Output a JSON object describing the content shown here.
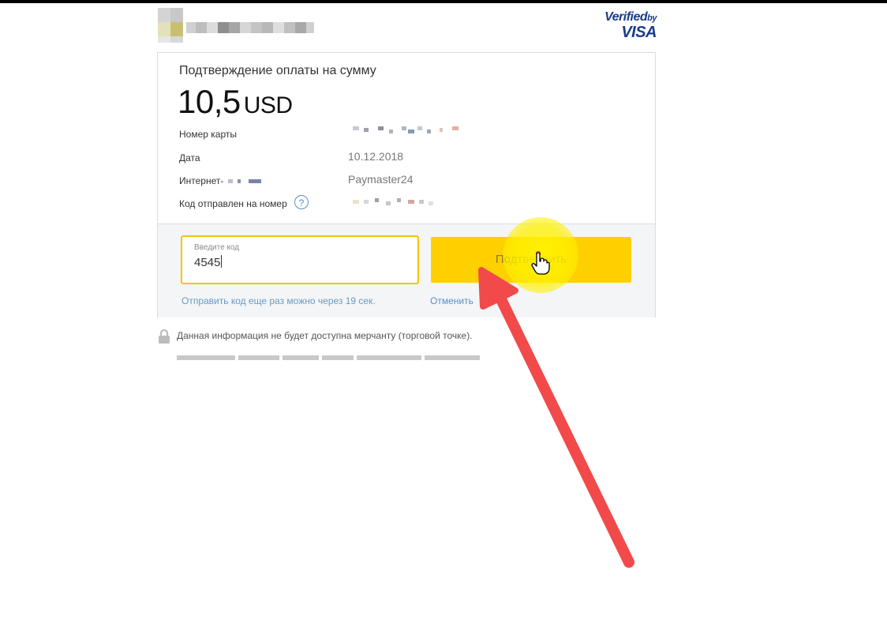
{
  "badge": {
    "verified": "Verified",
    "by": "by",
    "brand": "VISA"
  },
  "payment": {
    "heading": "Подтверждение оплаты на сумму",
    "amount": "10,5",
    "currency": "USD",
    "rows": [
      {
        "label": "Номер карты",
        "value": ""
      },
      {
        "label": "Дата",
        "value": "10.12.2018"
      },
      {
        "label": "Интернет-",
        "value": "Paymaster24"
      },
      {
        "label": "Код отправлен на номер",
        "value": ""
      }
    ],
    "help_symbol": "?"
  },
  "code_form": {
    "placeholder": "Введите код",
    "value": "4545",
    "confirm_label": "Подтвердить",
    "resend_text": "Отправить код еще раз можно через 19 сек.",
    "cancel_label": "Отменить"
  },
  "footer": {
    "note": "Данная информация не будет доступна мерчанту (торговой точке)."
  },
  "colors": {
    "accent_yellow": "#ffd000",
    "visa_blue": "#1a3c8c",
    "link_blue": "#5b8fc7",
    "annotation_red": "#f24a4a"
  }
}
